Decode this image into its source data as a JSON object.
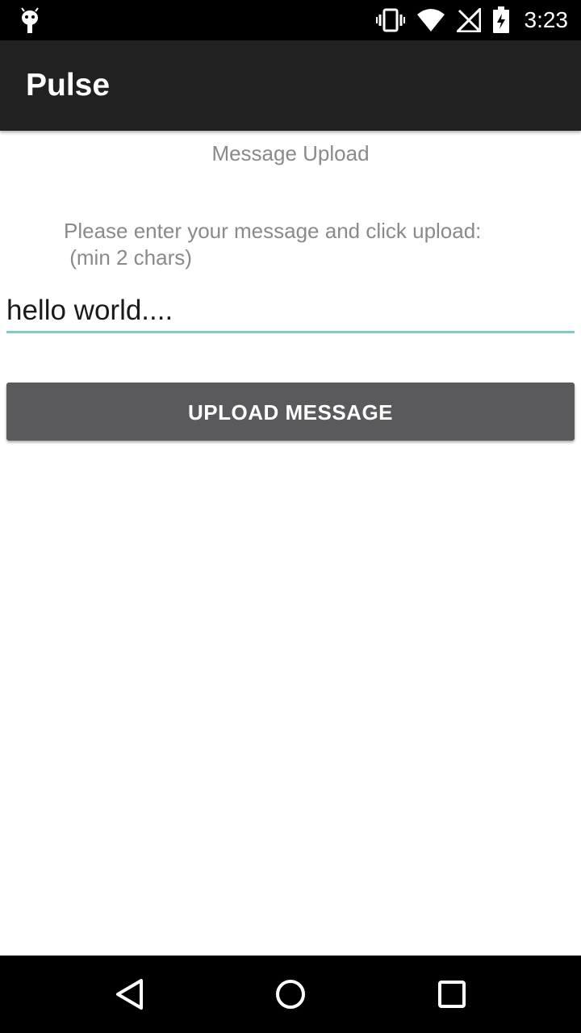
{
  "status_bar": {
    "time": "3:23",
    "icons": [
      "android-debug-icon",
      "vibrate-icon",
      "wifi-icon",
      "no-signal-icon",
      "battery-charging-icon"
    ]
  },
  "app_bar": {
    "title": "Pulse"
  },
  "content": {
    "section_title": "Message Upload",
    "instructions": "Please enter your message and click upload:\n (min 2 chars)",
    "message_input_value": "hello world....",
    "upload_button_label": "UPLOAD MESSAGE"
  },
  "nav_bar": {
    "buttons": [
      "back-icon",
      "home-icon",
      "recents-icon"
    ]
  },
  "colors": {
    "status_bar": "#000000",
    "app_bar": "#212121",
    "input_underline": "#80cbc4",
    "button": "#5a5a5c",
    "secondary_text": "#8a8a8a"
  }
}
